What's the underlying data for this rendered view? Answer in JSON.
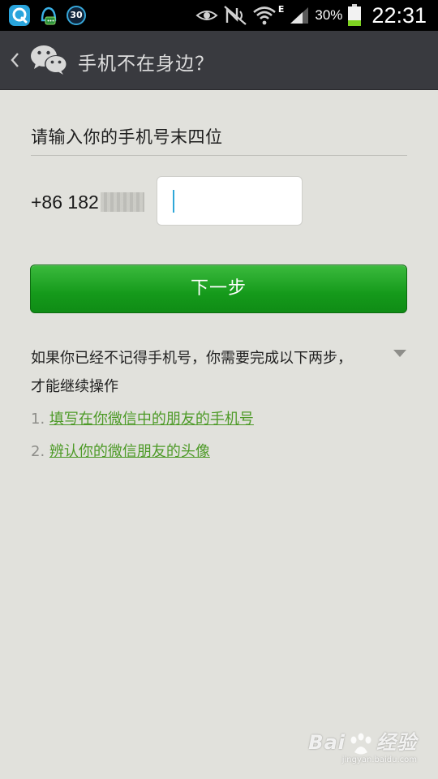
{
  "status_bar": {
    "notification_badge": "30",
    "network_type": "E",
    "battery_percent": "30%",
    "time": "22:31"
  },
  "action_bar": {
    "title": "手机不在身边？"
  },
  "form": {
    "prompt": "请输入你的手机号末四位",
    "phone_prefix": "+86 182",
    "input_value": "",
    "next_button_label": "下一步"
  },
  "help": {
    "line_1": "如果你已经不记得手机号，你需要完成以下两步，",
    "line_2": "才能继续操作",
    "steps": [
      {
        "number": "1.",
        "label": "填写在你微信中的朋友的手机号"
      },
      {
        "number": "2.",
        "label": "辨认你的微信朋友的头像"
      }
    ]
  },
  "watermark": {
    "brand_left": "Bai",
    "brand_right": "经验",
    "url": "jingyan.baidu.com"
  },
  "colors": {
    "status_bar_bg": "#000000",
    "action_bar_bg": "#393a3f",
    "page_bg": "#e1e1dc",
    "primary_button": "#1aa01f",
    "link": "#4d9a27",
    "cursor": "#2fa7d8"
  }
}
